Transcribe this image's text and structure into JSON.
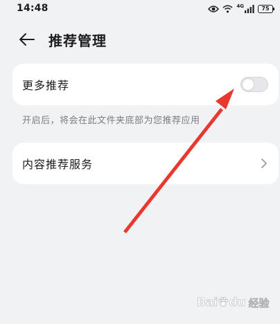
{
  "status_bar": {
    "time": "14:48",
    "network_label": "4G",
    "battery_level": "75",
    "icons": [
      "eye-icon",
      "wifi-icon",
      "cellular-signal-icon",
      "battery-icon"
    ]
  },
  "header": {
    "title": "推荐管理",
    "back_icon": "back-arrow-icon"
  },
  "more_recommendations": {
    "label": "更多推荐",
    "toggle_on": false
  },
  "description": "开启后，将会在此文件夹底部为您推荐应用",
  "content_service": {
    "label": "内容推荐服务",
    "chevron_icon": "chevron-right-icon"
  },
  "watermark": {
    "brand": "Bai",
    "brand_tail": "du",
    "sub": "经验"
  },
  "colors": {
    "background": "#f1f2f4",
    "card": "#ffffff",
    "toggle_track": "#e6e7ea",
    "annotation_red": "#e8382f",
    "description_text": "#7b7d82"
  }
}
